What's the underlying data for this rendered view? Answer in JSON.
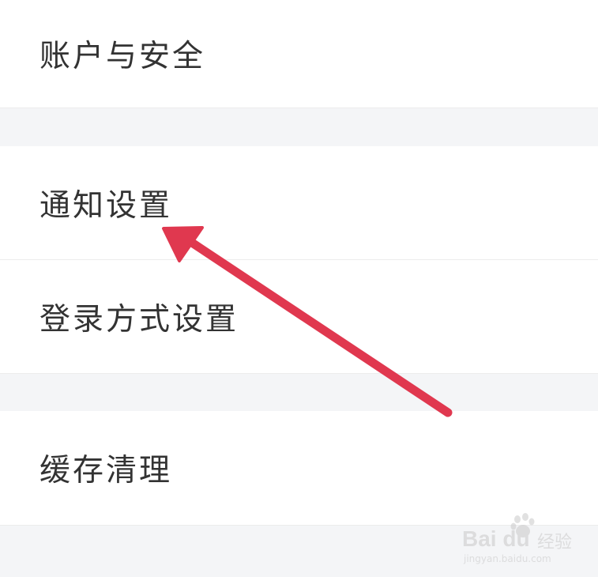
{
  "settings": {
    "items": [
      {
        "label": "账户与安全"
      },
      {
        "label": "通知设置"
      },
      {
        "label": "登录方式设置"
      },
      {
        "label": "缓存清理"
      }
    ]
  },
  "annotation": {
    "color": "#e0384f",
    "icon": "arrow-icon"
  },
  "watermark": {
    "brand": "Bai du",
    "brand_cn": "经验",
    "url": "jingyan.baidu.com"
  }
}
